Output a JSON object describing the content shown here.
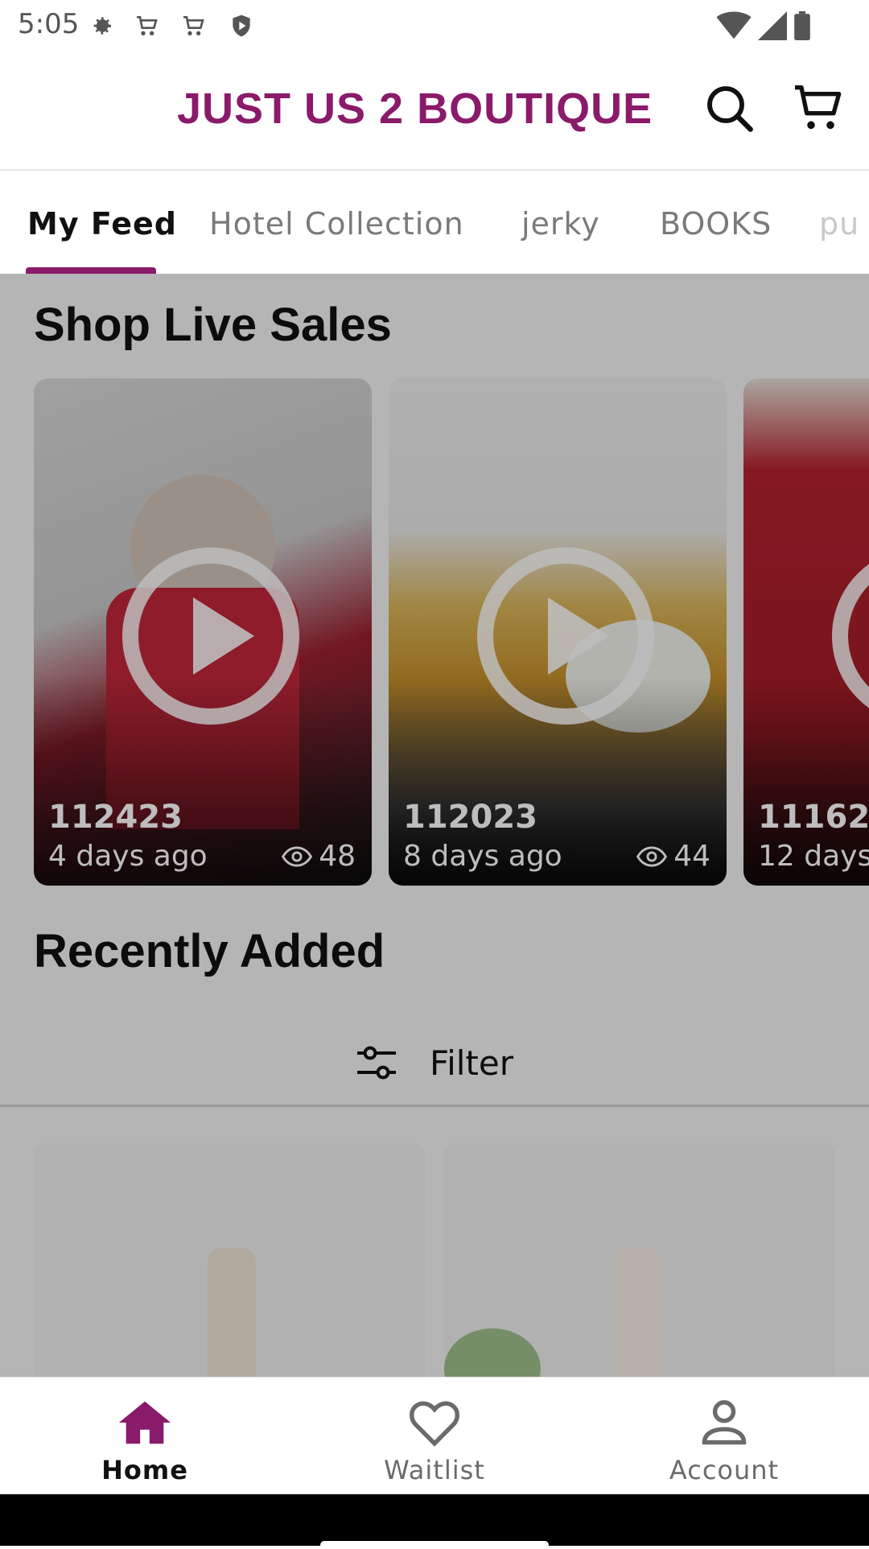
{
  "status": {
    "time": "5:05"
  },
  "header": {
    "brand": "JUST US 2 BOUTIQUE"
  },
  "tabs": [
    {
      "label": "My Feed",
      "active": true
    },
    {
      "label": "Hotel Collection",
      "active": false
    },
    {
      "label": "jerky",
      "active": false
    },
    {
      "label": "BOOKS",
      "active": false
    },
    {
      "label": "pu",
      "active": false
    }
  ],
  "live_sales": {
    "title": "Shop Live Sales",
    "cards": [
      {
        "title": "112423",
        "age": "4 days ago",
        "views": "48"
      },
      {
        "title": "112023",
        "age": "8 days ago",
        "views": "44"
      },
      {
        "title": "11162",
        "age": "12 days"
      }
    ]
  },
  "recently_added": {
    "title": "Recently Added",
    "filter_label": "Filter"
  },
  "bottom_nav": [
    {
      "label": "Home",
      "active": true
    },
    {
      "label": "Waitlist",
      "active": false
    },
    {
      "label": "Account",
      "active": false
    }
  ],
  "colors": {
    "brand": "#8a1a6a"
  }
}
